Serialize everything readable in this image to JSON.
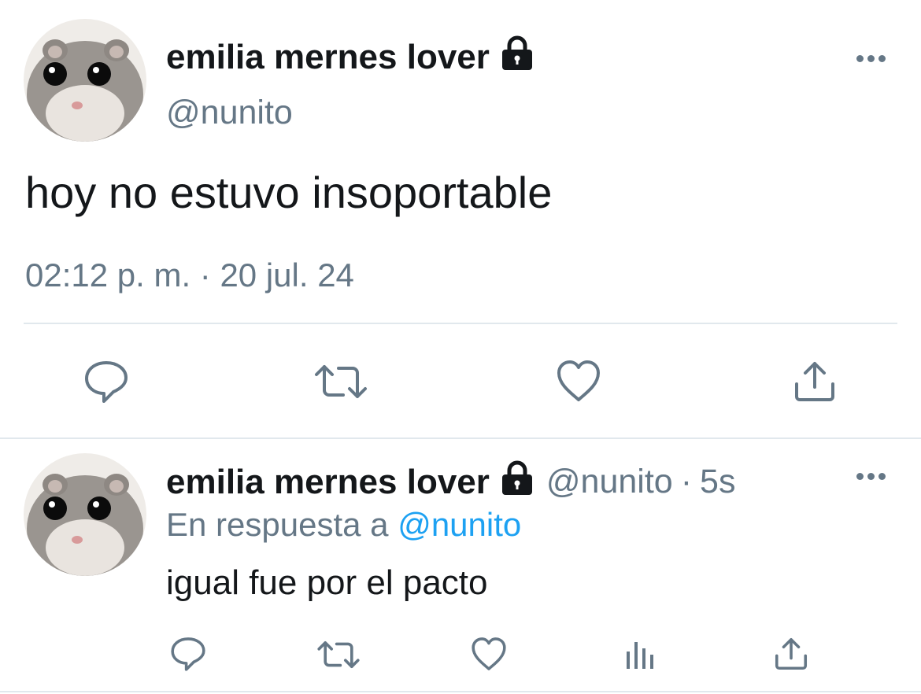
{
  "main_tweet": {
    "display_name": "emilia mernes lover",
    "handle": "@nunito",
    "text": "hoy no estuvo insoportable",
    "timestamp": "02:12 p. m. · 20 jul. 24",
    "avatar_icon": "hamster-avatar",
    "verified_icon": "lock-icon"
  },
  "reply_tweet": {
    "display_name": "emilia mernes lover",
    "handle": "@nunito",
    "separator": "·",
    "time_ago": "5s",
    "reply_prefix": "En respuesta a",
    "reply_mention": "@nunito",
    "text": "igual fue por el pacto"
  },
  "colors": {
    "text_primary": "#14171a",
    "text_secondary": "#657786",
    "link": "#1da1f2",
    "divider": "#e1e8ed"
  }
}
